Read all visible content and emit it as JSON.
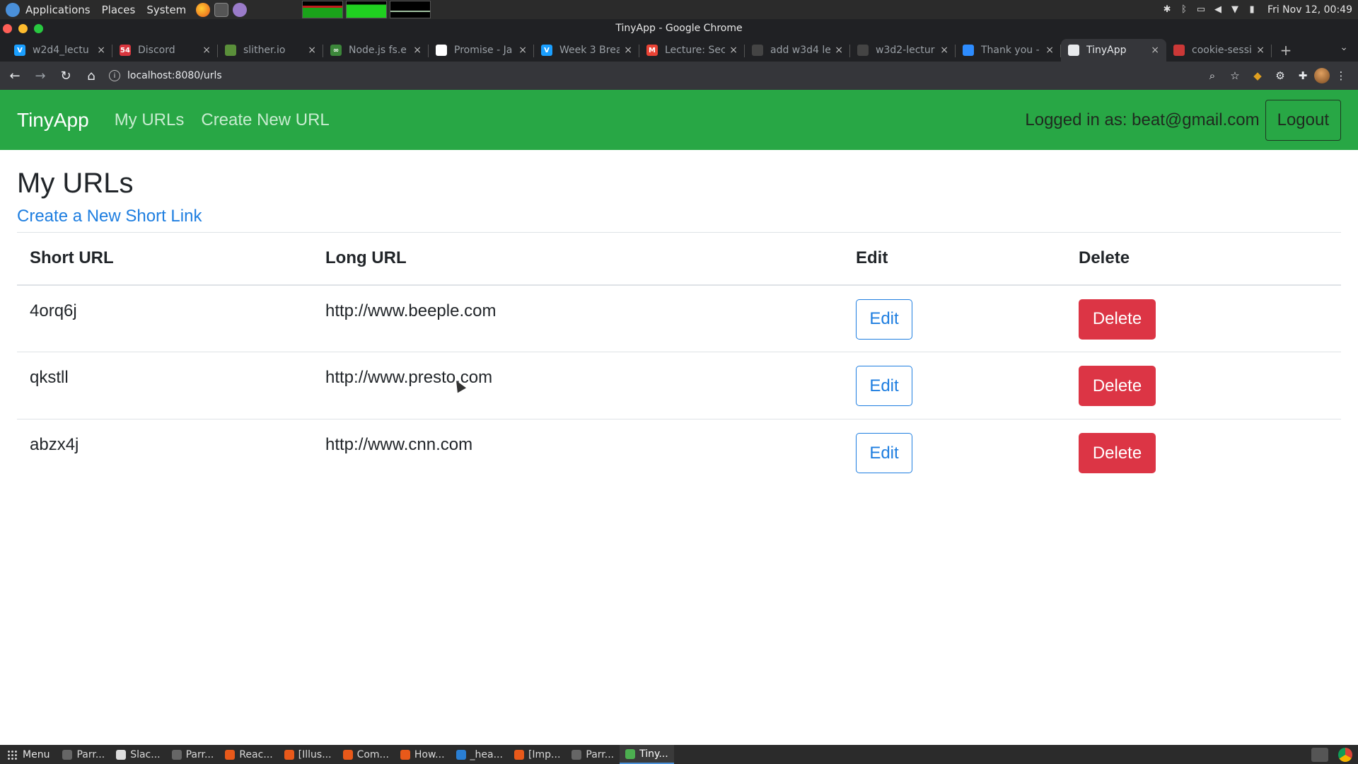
{
  "system_panel": {
    "menus": [
      "Applications",
      "Places",
      "System"
    ],
    "clock": "Fri Nov 12, 00:49"
  },
  "window": {
    "title": "TinyApp - Google Chrome"
  },
  "tabs": [
    {
      "label": "w2d4_lectu",
      "favicon_color": "#1a9fff",
      "favicon_glyph": "V"
    },
    {
      "label": "Discord",
      "favicon_color": "#d9363e",
      "favicon_glyph": "54"
    },
    {
      "label": "slither.io",
      "favicon_color": "#5a8f3a",
      "favicon_glyph": ""
    },
    {
      "label": "Node.js fs.e",
      "favicon_color": "#3c873a",
      "favicon_glyph": "∞"
    },
    {
      "label": "Promise - Ja",
      "favicon_color": "#ffffff",
      "favicon_glyph": ""
    },
    {
      "label": "Week 3 Brea",
      "favicon_color": "#1a9fff",
      "favicon_glyph": "V"
    },
    {
      "label": "Lecture: Sec",
      "favicon_color": "#ea4335",
      "favicon_glyph": "M"
    },
    {
      "label": "add w3d4 le",
      "favicon_color": "#444444",
      "favicon_glyph": ""
    },
    {
      "label": "w3d2-lectur",
      "favicon_color": "#444444",
      "favicon_glyph": ""
    },
    {
      "label": "Thank you -",
      "favicon_color": "#2d8cff",
      "favicon_glyph": ""
    },
    {
      "label": "TinyApp",
      "favicon_color": "#e8eaed",
      "favicon_glyph": "",
      "active": true
    },
    {
      "label": "cookie-sessi",
      "favicon_color": "#cb3837",
      "favicon_glyph": ""
    }
  ],
  "toolbar": {
    "url": "localhost:8080/urls"
  },
  "navbar": {
    "brand": "TinyApp",
    "links": [
      "My URLs",
      "Create New URL"
    ],
    "logged_in_text": "Logged in as: beat@gmail.com",
    "logout_label": "Logout"
  },
  "main": {
    "title": "My URLs",
    "create_link": "Create a New Short Link",
    "table": {
      "headers": [
        "Short URL",
        "Long URL",
        "Edit",
        "Delete"
      ],
      "rows": [
        {
          "short": "4orq6j",
          "long": "http://www.beeple.com",
          "edit": "Edit",
          "delete": "Delete"
        },
        {
          "short": "qkstll",
          "long": "http://www.presto.com",
          "edit": "Edit",
          "delete": "Delete"
        },
        {
          "short": "abzx4j",
          "long": "http://www.cnn.com",
          "edit": "Edit",
          "delete": "Delete"
        }
      ]
    }
  },
  "taskbar": {
    "menu_label": "Menu",
    "items": [
      {
        "label": "Parr...",
        "icon_color": "#666666"
      },
      {
        "label": "Slac...",
        "icon_color": "#dddddd"
      },
      {
        "label": "Parr...",
        "icon_color": "#666666"
      },
      {
        "label": "Reac...",
        "icon_color": "#e8591a"
      },
      {
        "label": "[Illus...",
        "icon_color": "#e8591a"
      },
      {
        "label": "Com...",
        "icon_color": "#e8591a"
      },
      {
        "label": "How...",
        "icon_color": "#e8591a"
      },
      {
        "label": "_hea...",
        "icon_color": "#2a7fd4"
      },
      {
        "label": "[Imp...",
        "icon_color": "#e8591a"
      },
      {
        "label": "Parr...",
        "icon_color": "#666666"
      },
      {
        "label": "Tiny...",
        "icon_color": "#4caf50",
        "active": true
      }
    ]
  },
  "colors": {
    "navbar": "#28a745",
    "link": "#1e7ee0",
    "danger": "#dc3545"
  }
}
